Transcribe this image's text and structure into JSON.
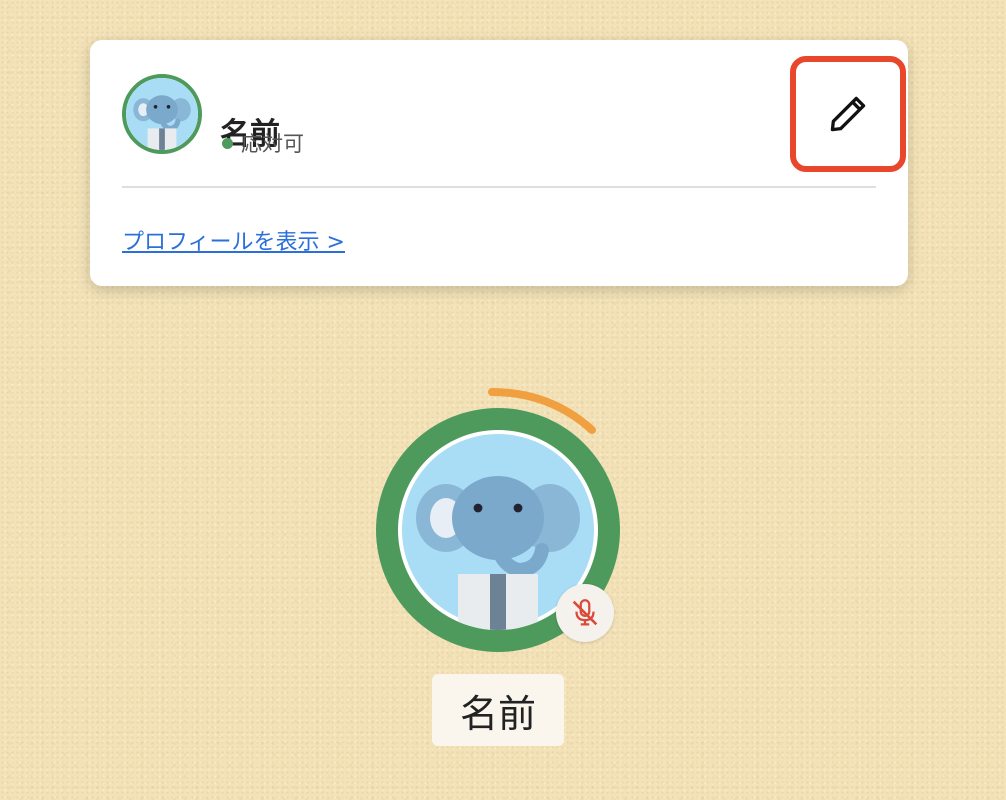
{
  "profile_card": {
    "name": "名前",
    "status": "応対可",
    "view_profile_link": "プロフィールを表示 >"
  },
  "icons": {
    "edit": "pencil-icon",
    "mic": "mic-muted-icon",
    "avatar": "elephant-avatar"
  },
  "participant": {
    "name": "名前"
  },
  "colors": {
    "status_available": "#4e9a5d",
    "highlight": "#e8472c",
    "link": "#2a6fdb",
    "progress_arc": "#f0a040"
  }
}
